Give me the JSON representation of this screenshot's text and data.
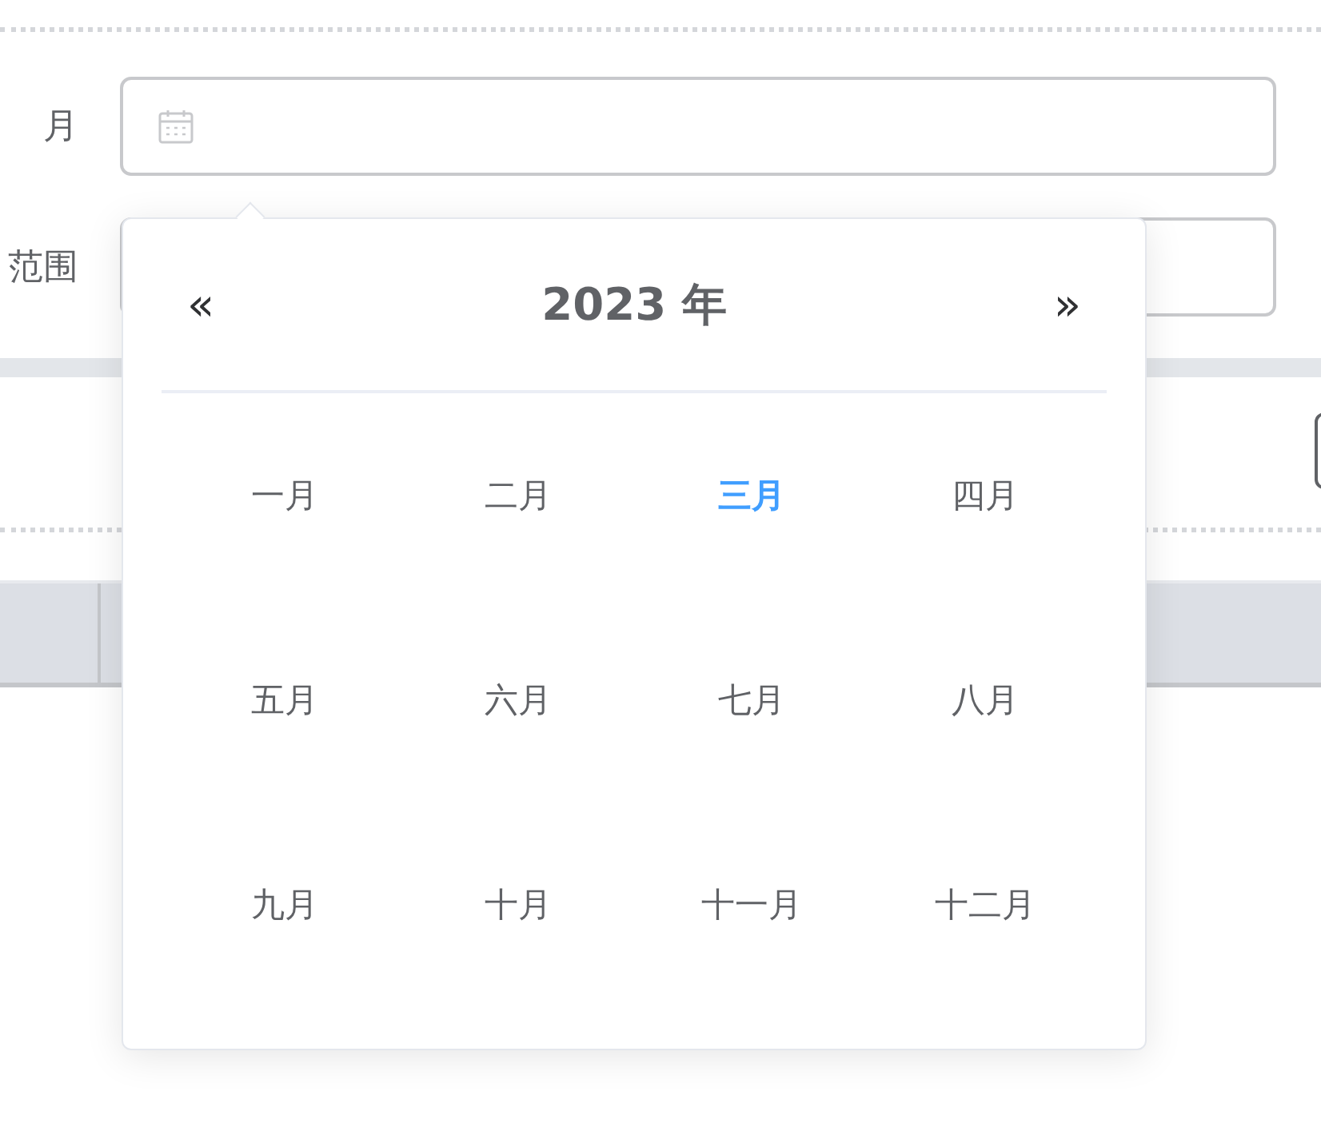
{
  "form": {
    "rows": [
      {
        "label": "月"
      },
      {
        "label": "范围"
      }
    ]
  },
  "picker": {
    "prev": "«",
    "year": "2023 年",
    "next": "»",
    "months": [
      {
        "label": "一月",
        "selected": false
      },
      {
        "label": "二月",
        "selected": false
      },
      {
        "label": "三月",
        "selected": true
      },
      {
        "label": "四月",
        "selected": false
      },
      {
        "label": "五月",
        "selected": false
      },
      {
        "label": "六月",
        "selected": false
      },
      {
        "label": "七月",
        "selected": false
      },
      {
        "label": "八月",
        "selected": false
      },
      {
        "label": "九月",
        "selected": false
      },
      {
        "label": "十月",
        "selected": false
      },
      {
        "label": "十一月",
        "selected": false
      },
      {
        "label": "十二月",
        "selected": false
      }
    ]
  }
}
